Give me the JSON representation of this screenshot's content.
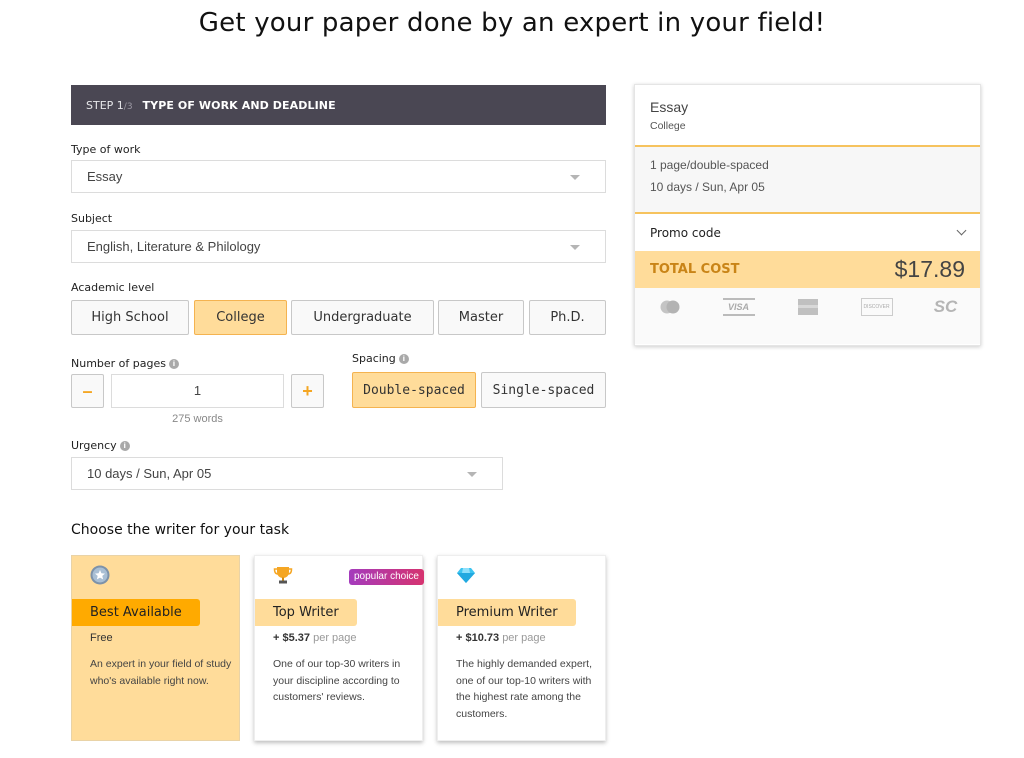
{
  "headline": "Get your paper done by an expert in your field!",
  "step": {
    "label": "STEP 1",
    "total": "/3",
    "title": "TYPE OF WORK AND DEADLINE"
  },
  "type_of_work": {
    "label": "Type of work",
    "value": "Essay"
  },
  "subject": {
    "label": "Subject",
    "value": "English, Literature & Philology"
  },
  "academic_level": {
    "label": "Academic level",
    "options": [
      "High School",
      "College",
      "Undergraduate",
      "Master",
      "Ph.D."
    ],
    "selected": "College"
  },
  "pages": {
    "label": "Number of pages",
    "info_icon": "info-icon",
    "minus": "–",
    "plus": "+",
    "value": "1",
    "words": "275 words"
  },
  "spacing": {
    "label": "Spacing",
    "options": [
      "Double-spaced",
      "Single-spaced"
    ],
    "selected": "Double-spaced"
  },
  "urgency": {
    "label": "Urgency",
    "value": "10 days / Sun, Apr 05"
  },
  "writers": {
    "heading": "Choose the writer for your task",
    "cards": [
      {
        "icon": "star-badge-icon",
        "name": "Best Available",
        "price": "Free",
        "per_page": "",
        "description": "An expert in your field of study who's available right now.",
        "selected": true
      },
      {
        "icon": "trophy-icon",
        "name": "Top Writer",
        "price": "+ $5.37",
        "per_page": "per page",
        "badge": "popular choice",
        "description": "One of our top-30 writers in your discipline according to customers' reviews.",
        "selected": false
      },
      {
        "icon": "diamond-icon",
        "name": "Premium Writer",
        "price": "+ $10.73",
        "per_page": "per page",
        "description": "The highly demanded expert, one of our top-10 writers with the highest rate among the customers.",
        "selected": false
      }
    ]
  },
  "summary": {
    "title": "Essay",
    "level": "College",
    "pages_line": "1 page/double-spaced",
    "deadline_line": "10 days / Sun, Apr 05",
    "promo_label": "Promo code",
    "total_label": "TOTAL COST",
    "total_value": "$17.89",
    "payment_methods": [
      "mastercard-icon",
      "visa-icon",
      "amex-icon",
      "discover-icon",
      "sc-icon"
    ],
    "payment_labels": {
      "visa": "VISA",
      "discover": "DISCOVER",
      "sc": "SC"
    }
  },
  "colors": {
    "accent": "#ffdc9a",
    "accent_strong": "#ffaa00",
    "step_bar": "#4a4753",
    "total_label": "#c98417"
  }
}
